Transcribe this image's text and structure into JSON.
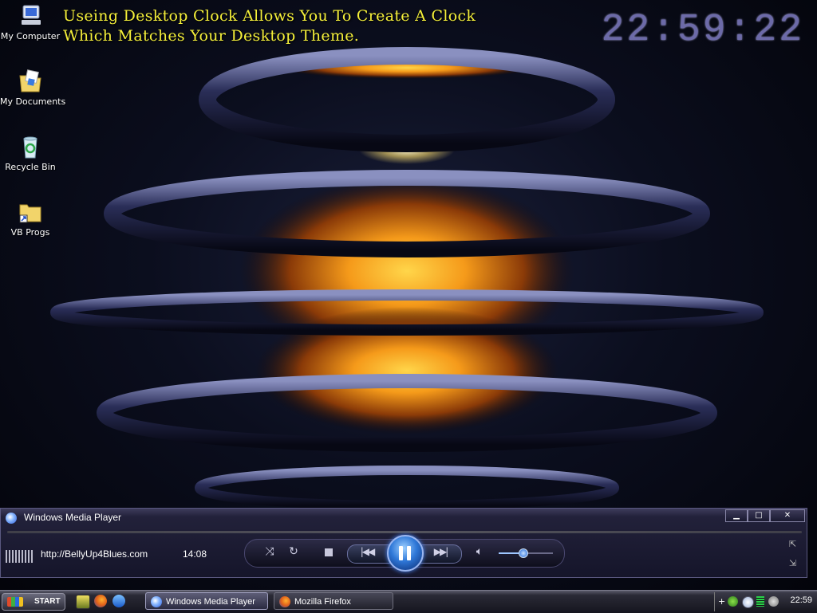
{
  "desktop": {
    "icons": [
      {
        "label": "My Computer",
        "icon": "computer-icon"
      },
      {
        "label": "My Documents",
        "icon": "documents-folder-icon"
      },
      {
        "label": "Recycle Bin",
        "icon": "recycle-bin-icon"
      },
      {
        "label": "VB Progs",
        "icon": "folder-shortcut-icon"
      }
    ],
    "headline": {
      "line1": "Useing Desktop Clock Allows You To Create A Clock",
      "line2": "Which Matches Your Desktop Theme."
    },
    "clock": "22:59:22",
    "colors": {
      "headline": "#f5f03a",
      "clock": "#6c6aa8"
    }
  },
  "media_player": {
    "title": "Windows Media Player",
    "window_buttons": {
      "minimize": "▁",
      "maximize": "□",
      "close": "✕"
    },
    "station": "http://BellyUp4Blues.com",
    "elapsed": "14:08",
    "state": "playing",
    "volume_fraction": 0.45,
    "controls": {
      "shuffle_icon": "shuffle-icon",
      "repeat_icon": "repeat-icon",
      "stop_icon": "stop-icon",
      "prev_icon": "previous-icon",
      "pause_icon": "pause-icon",
      "next_icon": "next-icon",
      "mute_icon": "speaker-icon"
    }
  },
  "taskbar": {
    "start_label": "START",
    "quick_launch": [
      "winamp-icon",
      "firefox-icon",
      "internet-explorer-icon"
    ],
    "tasks": [
      {
        "label": "Windows Media Player",
        "icon": "media-player-icon",
        "active": true
      },
      {
        "label": "Mozilla Firefox",
        "icon": "firefox-icon",
        "active": false
      }
    ],
    "tray_icons": [
      "add-icon",
      "messenger-icon",
      "clock-icon",
      "network-meter-icon",
      "audio-icon"
    ],
    "time": "22:59"
  }
}
